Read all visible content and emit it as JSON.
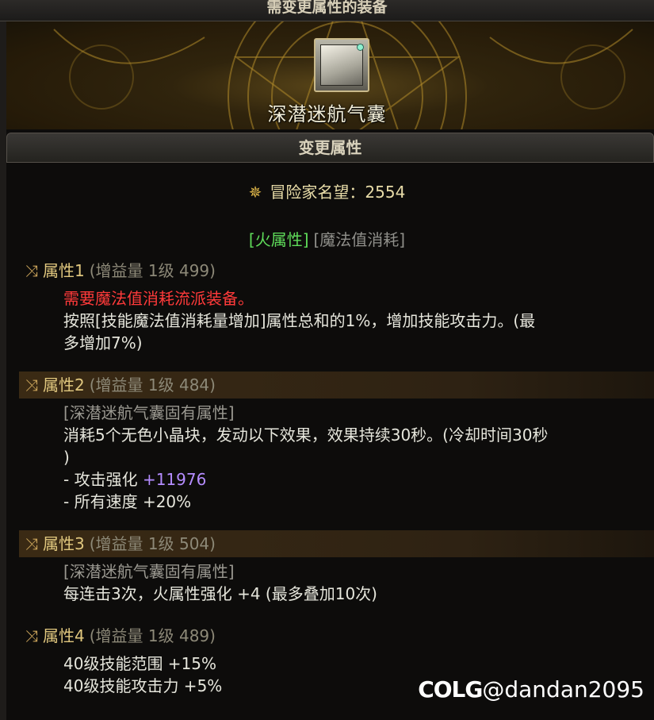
{
  "header": {
    "title": "需变更属性的装备"
  },
  "item": {
    "name": "深潜迷航气囊",
    "icon": "airbag-item-icon"
  },
  "section": {
    "title": "变更属性"
  },
  "fame": {
    "icon": "fame-crest-icon",
    "text": "冒险家名望：2554"
  },
  "tags": {
    "fire": "[火属性]",
    "mana": "[魔法值消耗]"
  },
  "attributes": [
    {
      "name": "属性1",
      "meta": "(增益量 1级 499)",
      "lines": [
        {
          "text": "需要魔法值消耗流派装备。",
          "color": "#ff3a3a"
        },
        {
          "text": "按照[技能魔法值消耗量增加]属性总和的1%，增加技能攻击力。(最"
        },
        {
          "text": "多增加7%)"
        }
      ]
    },
    {
      "name": "属性2",
      "meta": "(增益量 1级 484)",
      "lines": [
        {
          "text": "[深潜迷航气囊固有属性]",
          "color": "#9a9890"
        },
        {
          "text": "消耗5个无色小晶块，发动以下效果，效果持续30秒。(冷却时间30秒"
        },
        {
          "text": ")"
        },
        {
          "label": "- 攻击强化 ",
          "value": "+11976",
          "value_color": "#b48cff"
        },
        {
          "label": "- 所有速度 ",
          "value": "+20%"
        }
      ]
    },
    {
      "name": "属性3",
      "meta": "(增益量 1级 504)",
      "lines": [
        {
          "text": "[深潜迷航气囊固有属性]",
          "color": "#9a9890"
        },
        {
          "text": "每连击3次，火属性强化 +4 (最多叠加10次)"
        }
      ]
    },
    {
      "name": "属性4",
      "meta": "(增益量 1级 489)",
      "lines": [
        {
          "text": "40级技能范围 +15%"
        },
        {
          "text": "40级技能攻击力 +5%"
        }
      ]
    }
  ],
  "watermark": {
    "logo": "COLG",
    "handle": "@dandan2095"
  },
  "colors": {
    "gold": "#c9a35a",
    "fire_tag": "#5fdc5a",
    "warning": "#ff3a3a",
    "purple": "#b48cff"
  }
}
